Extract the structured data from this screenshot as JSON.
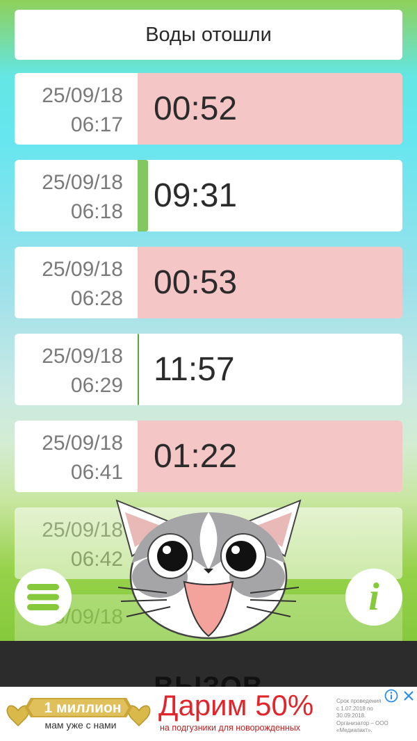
{
  "header": {
    "label": "Воды отошли"
  },
  "rows": [
    {
      "date": "25/09/18",
      "time": "06:17",
      "duration": "00:52",
      "kind": "contraction"
    },
    {
      "date": "25/09/18",
      "time": "06:18",
      "duration": "09:31",
      "kind": "interval",
      "fill": 0.04
    },
    {
      "date": "25/09/18",
      "time": "06:28",
      "duration": "00:53",
      "kind": "contraction"
    },
    {
      "date": "25/09/18",
      "time": "06:29",
      "duration": "11:57",
      "kind": "interval",
      "fill": 0.005
    },
    {
      "date": "25/09/18",
      "time": "06:41",
      "duration": "01:22",
      "kind": "contraction"
    },
    {
      "date": "25/09/18",
      "time": "06:42",
      "duration": "",
      "kind": "interval"
    },
    {
      "date": "25/09/18",
      "time": "",
      "duration": "",
      "kind": "interval"
    }
  ],
  "menu_button": {
    "icon": "hamburger-menu-icon"
  },
  "info_button": {
    "icon": "info-icon",
    "label": "i"
  },
  "mascot": {
    "icon": "cat-mascot-icon"
  },
  "bottom_peek": {
    "text": "ВЫЗОВ"
  },
  "ad": {
    "badge_line1": "1 миллион",
    "badge_line2": "мам уже с нами",
    "headline": "Дарим 50%",
    "subline": "на подгузники для новорожденных",
    "fine_print": [
      "Срок проведения",
      "с 1.07.2018 по 30.09.2018.",
      "Организатор – ООО",
      "«Медиапакт»."
    ],
    "info_icon": "ad-info-icon",
    "close_icon": "ad-close-icon"
  },
  "colors": {
    "contraction": "#f4c7c6",
    "interval_bar": "#83c763",
    "ad_red": "#e1262b"
  }
}
